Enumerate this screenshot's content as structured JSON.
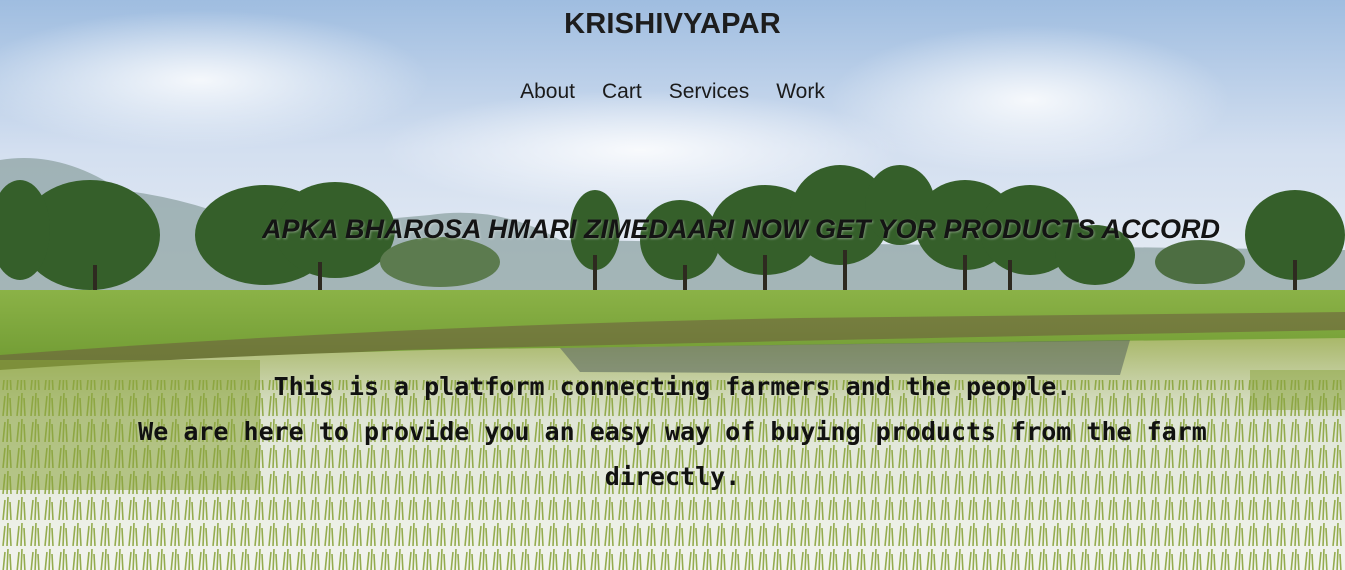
{
  "site": {
    "brand": "KRISHIVYAPAR"
  },
  "nav": {
    "items": [
      {
        "label": "About"
      },
      {
        "label": "Cart"
      },
      {
        "label": "Services"
      },
      {
        "label": "Work"
      }
    ]
  },
  "marquee": {
    "text": "APKA BHAROSA HMARI ZIMEDAARI NOW GET YOR PRODUCTS ACCORD"
  },
  "intro": {
    "line1": "This is a platform connecting farmers and the people.",
    "line2": "We are here to provide you an easy way of buying products from the farm directly."
  },
  "colors": {
    "sky": "#c9d9ee",
    "field_green": "#7fa83a",
    "water": "#cfd6de",
    "text": "#111111"
  }
}
